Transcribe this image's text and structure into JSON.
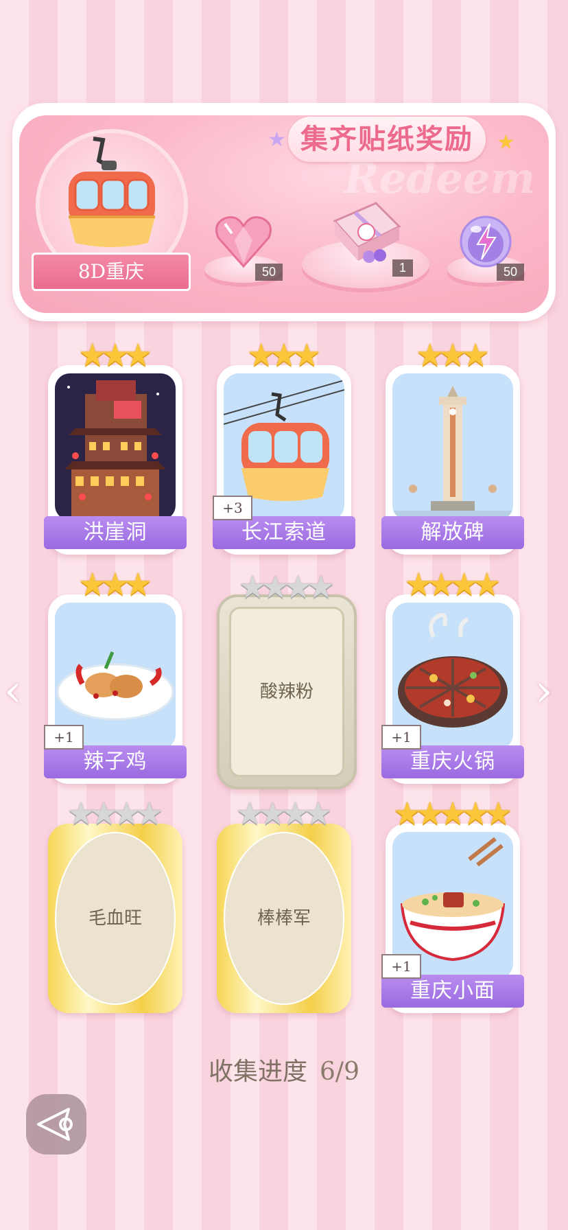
{
  "banner": {
    "title": "集齐贴纸奖励",
    "watermark": "Redeem",
    "city_label": "8D重庆",
    "rewards": [
      {
        "icon": "pink-heart-gem-icon",
        "count": "50"
      },
      {
        "icon": "gift-box-icon",
        "count": "1"
      },
      {
        "icon": "purple-lightning-orb-icon",
        "count": "50"
      }
    ]
  },
  "stickers": [
    {
      "name": "洪崖洞",
      "stars": 3,
      "max_stars": 3,
      "collected": true,
      "bonus": "",
      "icon": "hongyadong-building-icon"
    },
    {
      "name": "长江索道",
      "stars": 3,
      "max_stars": 3,
      "collected": true,
      "bonus": "+3",
      "icon": "cable-car-icon"
    },
    {
      "name": "解放碑",
      "stars": 3,
      "max_stars": 3,
      "collected": true,
      "bonus": "",
      "icon": "monument-tower-icon"
    },
    {
      "name": "辣子鸡",
      "stars": 3,
      "max_stars": 3,
      "collected": true,
      "bonus": "+1",
      "icon": "spicy-chicken-icon"
    },
    {
      "name": "酸辣粉",
      "stars": 0,
      "max_stars": 4,
      "collected": false,
      "bonus": "",
      "icon": ""
    },
    {
      "name": "重庆火锅",
      "stars": 4,
      "max_stars": 4,
      "collected": true,
      "bonus": "+1",
      "icon": "hotpot-icon"
    },
    {
      "name": "毛血旺",
      "stars": 0,
      "max_stars": 4,
      "collected": false,
      "bonus": "",
      "icon": ""
    },
    {
      "name": "棒棒军",
      "stars": 0,
      "max_stars": 4,
      "collected": false,
      "bonus": "",
      "icon": ""
    },
    {
      "name": "重庆小面",
      "stars": 5,
      "max_stars": 5,
      "collected": true,
      "bonus": "+1",
      "icon": "noodle-bowl-icon"
    }
  ],
  "progress": {
    "label": "收集进度",
    "value": "6/9"
  },
  "colors": {
    "accent_pink": "#ec6a8c",
    "label_purple": "#9a6ae0",
    "star_gold": "#fcc63a"
  }
}
